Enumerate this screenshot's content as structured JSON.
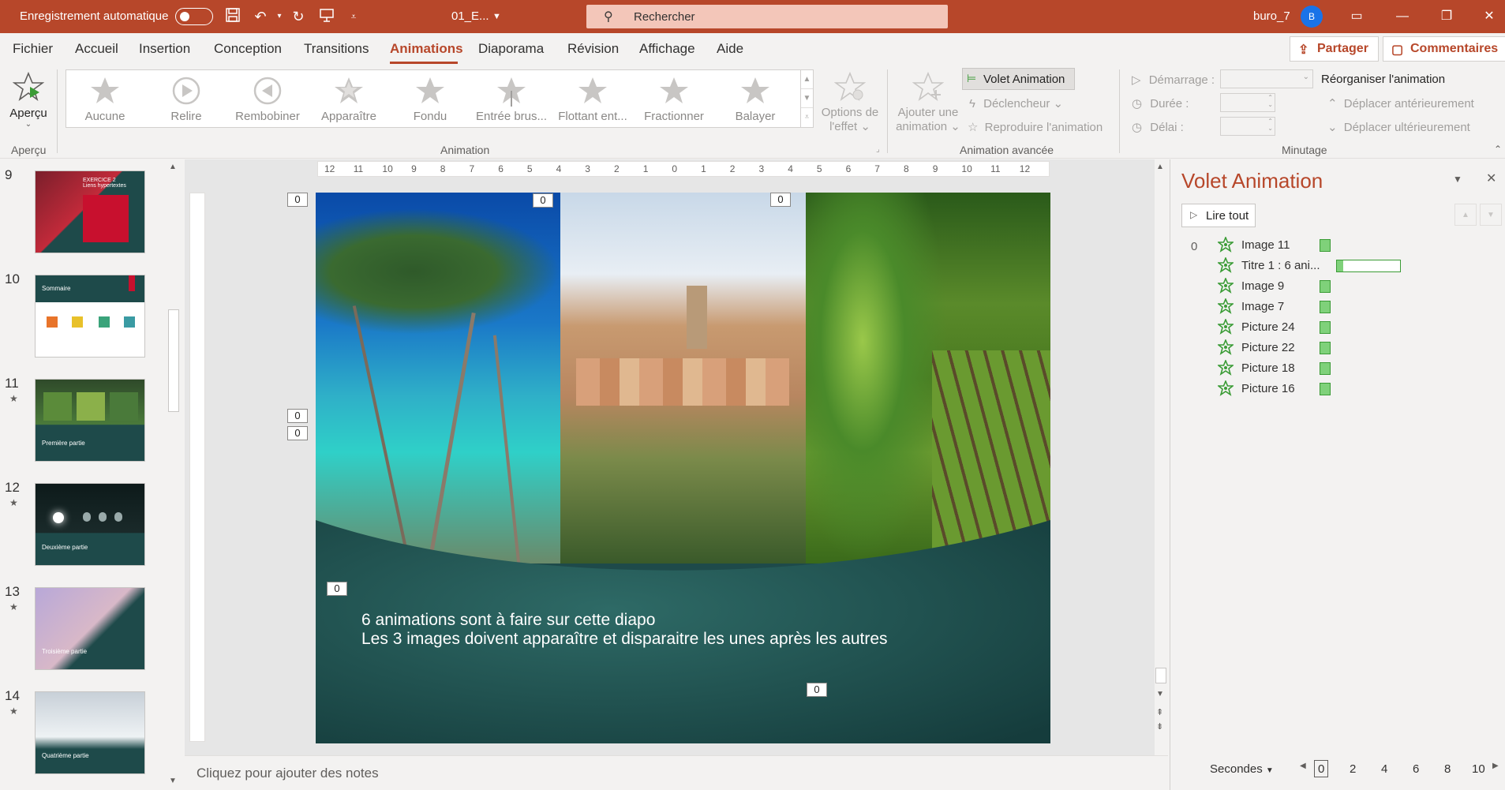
{
  "titlebar": {
    "autosave_label": "Enregistrement automatique",
    "doc_name": "01_E...",
    "search_placeholder": "Rechercher",
    "user_name": "buro_7",
    "avatar_initial": "B",
    "accent": "#b7472a"
  },
  "tabs": [
    "Fichier",
    "Accueil",
    "Insertion",
    "Conception",
    "Transitions",
    "Animations",
    "Diaporama",
    "Révision",
    "Affichage",
    "Aide"
  ],
  "active_tab": "Animations",
  "actions": {
    "share": "Partager",
    "comments": "Commentaires"
  },
  "ribbon": {
    "preview": {
      "label": "Aperçu",
      "group": "Aperçu"
    },
    "animation_group": "Animation",
    "gallery": [
      "Aucune",
      "Relire",
      "Rembobiner",
      "Apparaître",
      "Fondu",
      "Entrée brus...",
      "Flottant ent...",
      "Fractionner",
      "Balayer"
    ],
    "effect_options_1": "Options de",
    "effect_options_2": "l'effet",
    "add_animation_1": "Ajouter une",
    "add_animation_2": "animation",
    "animation_pane": "Volet Animation",
    "trigger": "Déclencheur",
    "painter": "Reproduire l'animation",
    "advanced_group": "Animation avancée",
    "start": "Démarrage :",
    "duration": "Durée :",
    "delay": "Délai :",
    "reorder": "Réorganiser l'animation",
    "move_earlier": "Déplacer antérieurement",
    "move_later": "Déplacer ultérieurement",
    "timing_group": "Minutage"
  },
  "slides": [
    {
      "num": "9",
      "star": "",
      "title": "EXERCICE 2 Liens hypertextes"
    },
    {
      "num": "10",
      "star": "",
      "title": "Sommaire"
    },
    {
      "num": "11",
      "star": "★",
      "title": "Première partie"
    },
    {
      "num": "12",
      "star": "★",
      "title": "Deuxième partie"
    },
    {
      "num": "13",
      "star": "★",
      "title": "Troisième partie"
    },
    {
      "num": "14",
      "star": "★",
      "title": "Quatrième partie"
    }
  ],
  "ruler_h": [
    "12",
    "11",
    "10",
    "9",
    "8",
    "7",
    "6",
    "5",
    "4",
    "3",
    "2",
    "1",
    "0",
    "1",
    "2",
    "3",
    "4",
    "5",
    "6",
    "7",
    "8",
    "9",
    "10",
    "11",
    "12"
  ],
  "slide": {
    "line1": "6 animations sont à faire sur cette diapo",
    "line2": "Les 3 images doivent apparaître et disparaitre les unes après les autres",
    "tag": "0"
  },
  "notes_placeholder": "Cliquez pour ajouter des notes",
  "pane": {
    "title": "Volet Animation",
    "play_all": "Lire tout",
    "group_index": "0",
    "items": [
      "Image 11",
      "Titre 1 : 6 ani...",
      "Image 9",
      "Image 7",
      "Picture 24",
      "Picture 22",
      "Picture 18",
      "Picture 16"
    ],
    "seconds_label": "Secondes",
    "ticks": [
      "0",
      "2",
      "4",
      "6",
      "8",
      "10"
    ]
  }
}
